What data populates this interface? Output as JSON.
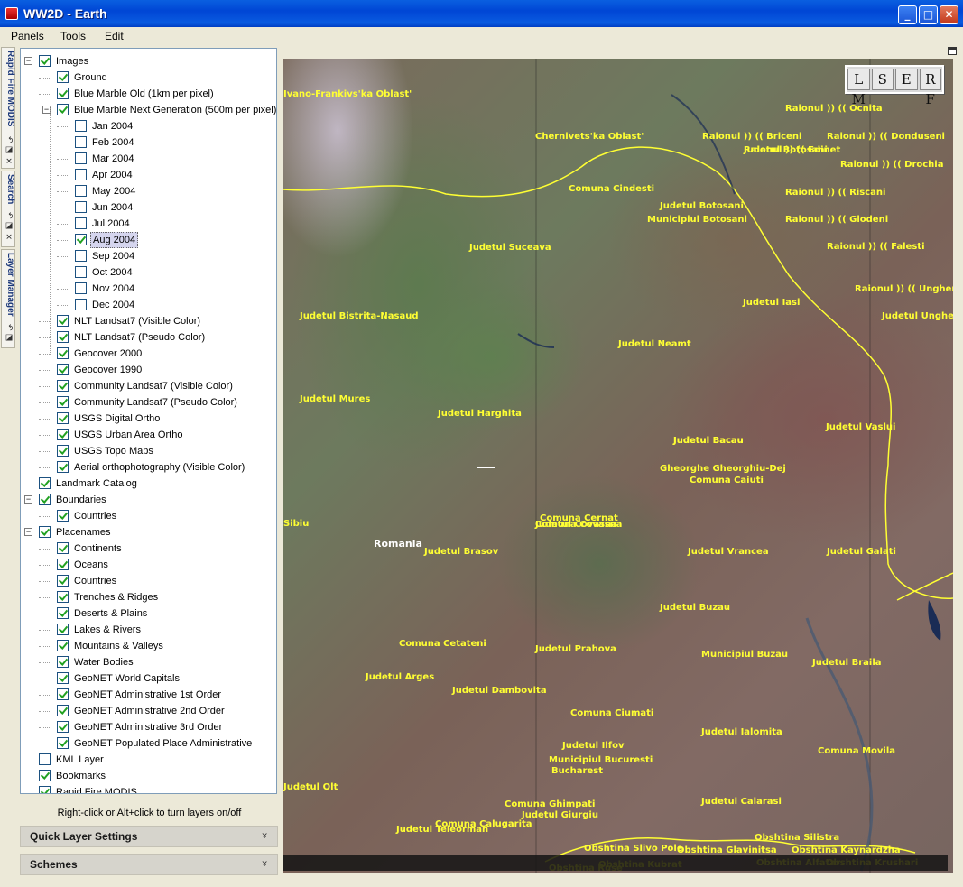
{
  "window": {
    "title": "WW2D - Earth",
    "minimize": "_",
    "maximize": "□",
    "close": "✕"
  },
  "menu": [
    "Panels",
    "Tools",
    "Edit"
  ],
  "side_tabs": [
    {
      "label": "Rapid Fire MODIS",
      "icons": "↶ ◪ ✕"
    },
    {
      "label": "Search",
      "icons": "↶ ◪ ✕"
    },
    {
      "label": "Layer Manager",
      "icons": "↶ ◪"
    }
  ],
  "layers": [
    {
      "label": "Images",
      "level": 0,
      "checked": true,
      "expander": "−"
    },
    {
      "label": "Ground",
      "level": 1,
      "checked": true
    },
    {
      "label": "Blue Marble Old (1km per pixel)",
      "level": 1,
      "checked": true
    },
    {
      "label": "Blue Marble Next Generation (500m per pixel)",
      "level": 1,
      "checked": true,
      "expander": "−"
    },
    {
      "label": "Jan 2004",
      "level": 2,
      "checked": false
    },
    {
      "label": "Feb 2004",
      "level": 2,
      "checked": false
    },
    {
      "label": "Mar 2004",
      "level": 2,
      "checked": false
    },
    {
      "label": "Apr 2004",
      "level": 2,
      "checked": false
    },
    {
      "label": "May 2004",
      "level": 2,
      "checked": false
    },
    {
      "label": "Jun 2004",
      "level": 2,
      "checked": false
    },
    {
      "label": "Jul 2004",
      "level": 2,
      "checked": false
    },
    {
      "label": "Aug 2004",
      "level": 2,
      "checked": true,
      "selected": true
    },
    {
      "label": "Sep 2004",
      "level": 2,
      "checked": false
    },
    {
      "label": "Oct 2004",
      "level": 2,
      "checked": false
    },
    {
      "label": "Nov 2004",
      "level": 2,
      "checked": false
    },
    {
      "label": "Dec 2004",
      "level": 2,
      "checked": false
    },
    {
      "label": "NLT Landsat7 (Visible Color)",
      "level": 1,
      "checked": true
    },
    {
      "label": "NLT Landsat7 (Pseudo Color)",
      "level": 1,
      "checked": true
    },
    {
      "label": "Geocover 2000",
      "level": 1,
      "checked": true
    },
    {
      "label": "Geocover 1990",
      "level": 1,
      "checked": true
    },
    {
      "label": "Community Landsat7 (Visible Color)",
      "level": 1,
      "checked": true
    },
    {
      "label": "Community Landsat7 (Pseudo Color)",
      "level": 1,
      "checked": true
    },
    {
      "label": "USGS Digital Ortho",
      "level": 1,
      "checked": true
    },
    {
      "label": "USGS Urban Area Ortho",
      "level": 1,
      "checked": true
    },
    {
      "label": "USGS Topo Maps",
      "level": 1,
      "checked": true
    },
    {
      "label": "Aerial orthophotography (Visible Color)",
      "level": 1,
      "checked": true
    },
    {
      "label": "Landmark Catalog",
      "level": 0,
      "checked": true
    },
    {
      "label": "Boundaries",
      "level": 0,
      "checked": true,
      "expander": "−"
    },
    {
      "label": "Countries",
      "level": 1,
      "checked": true
    },
    {
      "label": "Placenames",
      "level": 0,
      "checked": true,
      "expander": "−"
    },
    {
      "label": "Continents",
      "level": 1,
      "checked": true
    },
    {
      "label": "Oceans",
      "level": 1,
      "checked": true
    },
    {
      "label": "Countries",
      "level": 1,
      "checked": true
    },
    {
      "label": "Trenches & Ridges",
      "level": 1,
      "checked": true
    },
    {
      "label": "Deserts & Plains",
      "level": 1,
      "checked": true
    },
    {
      "label": "Lakes & Rivers",
      "level": 1,
      "checked": true
    },
    {
      "label": "Mountains & Valleys",
      "level": 1,
      "checked": true
    },
    {
      "label": "Water Bodies",
      "level": 1,
      "checked": true
    },
    {
      "label": "GeoNET World Capitals",
      "level": 1,
      "checked": true
    },
    {
      "label": "GeoNET Administrative 1st Order",
      "level": 1,
      "checked": true
    },
    {
      "label": "GeoNET Administrative 2nd Order",
      "level": 1,
      "checked": true
    },
    {
      "label": "GeoNET Administrative 3rd Order",
      "level": 1,
      "checked": true
    },
    {
      "label": "GeoNET Populated Place Administrative",
      "level": 1,
      "checked": true
    },
    {
      "label": "KML Layer",
      "level": 0,
      "checked": false
    },
    {
      "label": "Bookmarks",
      "level": 0,
      "checked": true
    },
    {
      "label": "Rapid Fire MODIS",
      "level": 0,
      "checked": true
    }
  ],
  "hint": "Right-click or Alt+click to turn layers on/off",
  "sections": [
    {
      "title": "Quick Layer Settings",
      "chevron": "»"
    },
    {
      "title": "Schemes",
      "chevron": "»"
    }
  ],
  "map_controls": [
    "L M",
    "S",
    "E",
    "R F"
  ],
  "map_labels": [
    {
      "text": "Ivano-Frankivs'ka Oblast'",
      "pos": "a"
    },
    {
      "text": "Raionul )) (( Ocnita",
      "pos": "b"
    },
    {
      "text": "Chernivets'ka Oblast'",
      "pos": "c"
    },
    {
      "text": "Raionul )) (( Briceni",
      "pos": "d"
    },
    {
      "text": "Raionul )) (( Donduseni",
      "pos": "e"
    },
    {
      "text": "Judetul Botosani",
      "pos": "f"
    },
    {
      "text": "Raionul )) (( Drochia",
      "pos": "g"
    },
    {
      "text": "Comuna Cindesti",
      "pos": "h"
    },
    {
      "text": "Raionul )) (( Riscani",
      "pos": "i"
    },
    {
      "text": "Judetul Botosani",
      "pos": "j"
    },
    {
      "text": "Municipiul Botosani",
      "pos": "k"
    },
    {
      "text": "Raionul )) (( Glodeni",
      "pos": "l"
    },
    {
      "text": "Raionul )) (( Falesti",
      "pos": "m"
    },
    {
      "text": "Judetul Suceava",
      "pos": "n"
    },
    {
      "text": "Judetul Iasi",
      "pos": "o"
    },
    {
      "text": "Raionul )) (( Ungheni",
      "pos": "p"
    },
    {
      "text": "Judetul Unghe",
      "pos": "q"
    },
    {
      "text": "Judetul Bistrita-Nasaud",
      "pos": "r"
    },
    {
      "text": "Judetul Neamt",
      "pos": "s"
    },
    {
      "text": "Judetul Mures",
      "pos": "t"
    },
    {
      "text": "Judetul Harghita",
      "pos": "u"
    },
    {
      "text": "Judetul Vaslui",
      "pos": "v"
    },
    {
      "text": "Judetul Bacau",
      "pos": "w"
    },
    {
      "text": "Gheorghe Gheorghiu-Dej",
      "pos": "x"
    },
    {
      "text": "Comuna Caiuti",
      "pos": "y"
    },
    {
      "text": "Sibiu",
      "pos": "z"
    },
    {
      "text": "Comuna Cernat",
      "pos": "aa"
    },
    {
      "text": "Judetul Covasna",
      "pos": "ab"
    },
    {
      "text": "Romania",
      "pos": "ac",
      "white": true
    },
    {
      "text": "Judetul Brasov",
      "pos": "ad"
    },
    {
      "text": "Judetul Vrancea",
      "pos": "ae"
    },
    {
      "text": "Judetul Galati",
      "pos": "af"
    },
    {
      "text": "Judetul Buzau",
      "pos": "ag"
    },
    {
      "text": "Comuna Cetateni",
      "pos": "ah"
    },
    {
      "text": "Judetul Prahova",
      "pos": "ai"
    },
    {
      "text": "Municipiul Buzau",
      "pos": "aj"
    },
    {
      "text": "Judetul Braila",
      "pos": "ak"
    },
    {
      "text": "Judetul Arges",
      "pos": "al"
    },
    {
      "text": "Judetul Dambovita",
      "pos": "am"
    },
    {
      "text": "Comuna Ciumati",
      "pos": "an"
    },
    {
      "text": "Judetul Ialomita",
      "pos": "ao"
    },
    {
      "text": "Judetul Ilfov",
      "pos": "ap"
    },
    {
      "text": "Comuna Movila",
      "pos": "aq"
    },
    {
      "text": "Municipiul Bucuresti",
      "pos": "ar"
    },
    {
      "text": "Bucharest",
      "pos": "as"
    },
    {
      "text": "Judetul Olt",
      "pos": "at"
    },
    {
      "text": "Comuna Ghimpati",
      "pos": "au"
    },
    {
      "text": "Judetul Calarasi",
      "pos": "av"
    },
    {
      "text": "Judetul Giurgiu",
      "pos": "aw"
    },
    {
      "text": "Comuna Calugarita",
      "pos": "ax"
    },
    {
      "text": "Judetul Teleorman",
      "pos": "ay"
    },
    {
      "text": "Obshtina Silistra",
      "pos": "az"
    },
    {
      "text": "Obshtina Slivo Pole",
      "pos": "ba"
    },
    {
      "text": "Obshtina Glavinitsa",
      "pos": "bb"
    },
    {
      "text": "Obshtina Kaynardzha",
      "pos": "bc"
    },
    {
      "text": "Obshtina Alfatar",
      "pos": "bd"
    },
    {
      "text": "Obshtina Krushari",
      "pos": "be"
    },
    {
      "text": "Obshtina Kubrat",
      "pos": "bf"
    },
    {
      "text": "Obshtina Ruse",
      "pos": "bg"
    },
    {
      "text": "Raionul )) (( Edinet",
      "pos": "bh"
    },
    {
      "text": "Judetul Bacau",
      "pos": "bi"
    },
    {
      "text": "Comuna Covasna",
      "pos": "bj"
    }
  ],
  "colors": {
    "boundary": "#ffff33",
    "label": "#ffff33",
    "title_bar": "#0a5fe0"
  }
}
